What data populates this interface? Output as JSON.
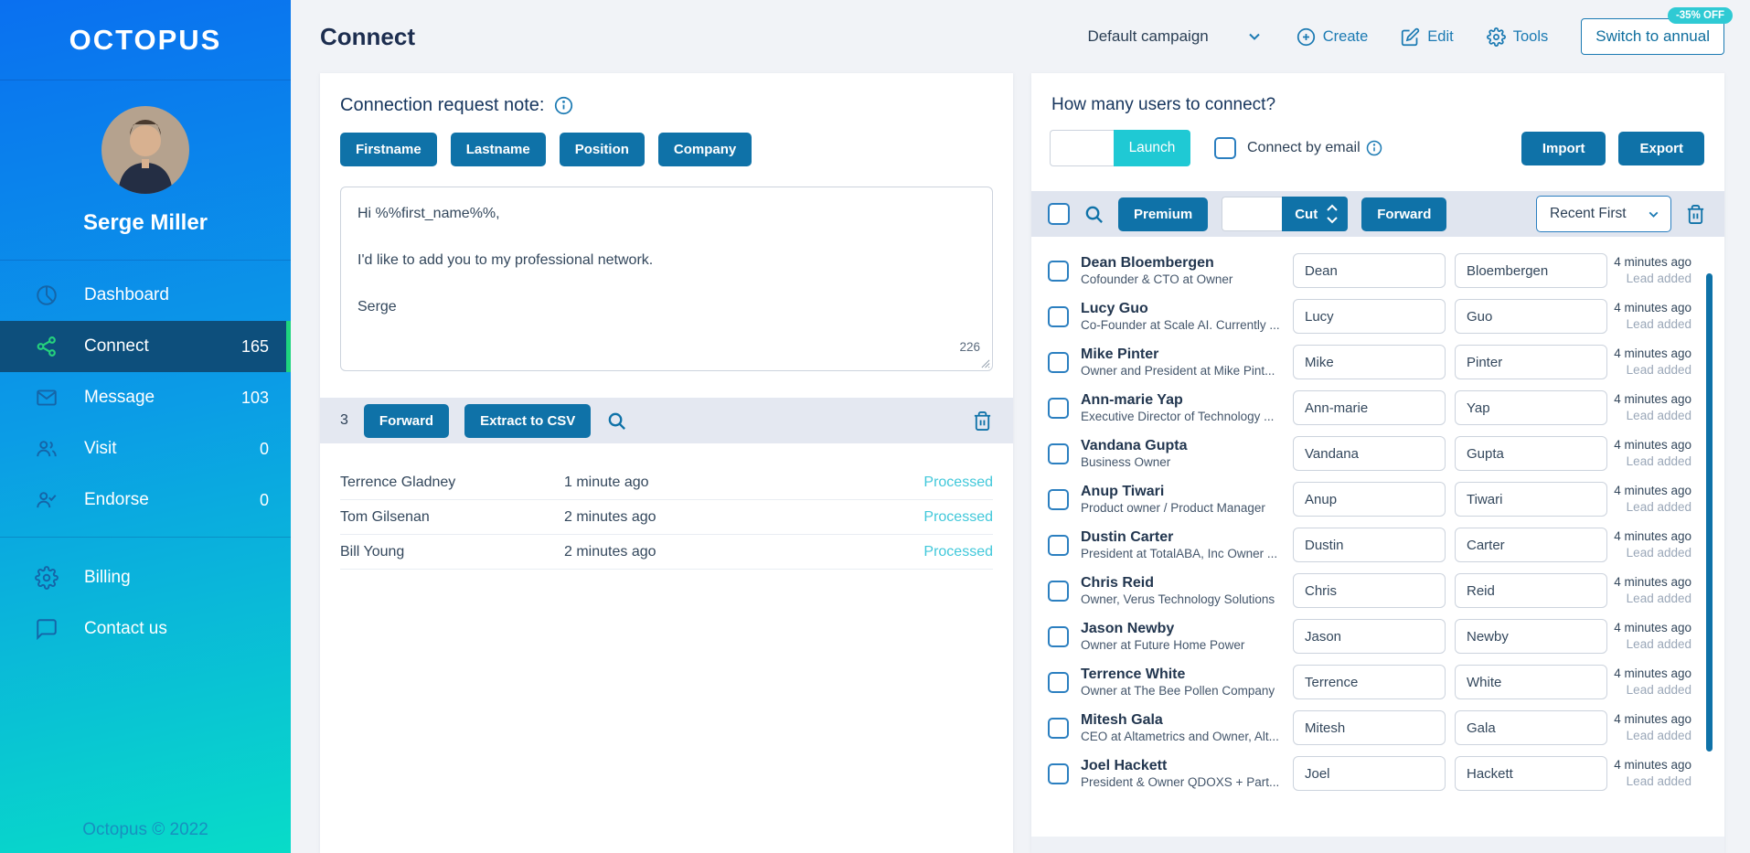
{
  "colors": {
    "accent_blue": "#0f72a8",
    "link_blue": "#1b7ab3",
    "turquoise": "#1fc9d4",
    "status_teal": "#41c8da",
    "active_nav_bg": "#0d4f7c",
    "active_nav_green": "#1ed47e",
    "sidebar_gradient_top": "#0a70f0",
    "sidebar_gradient_bottom": "#08dcc8"
  },
  "sidebar": {
    "logo": "OCTOPUS",
    "user_name": "Serge Miller",
    "items": [
      {
        "label": "Dashboard",
        "count": "",
        "icon": "pie-chart"
      },
      {
        "label": "Connect",
        "count": "165",
        "icon": "share"
      },
      {
        "label": "Message",
        "count": "103",
        "icon": "envelope"
      },
      {
        "label": "Visit",
        "count": "0",
        "icon": "people"
      },
      {
        "label": "Endorse",
        "count": "0",
        "icon": "person-check"
      }
    ],
    "secondary": [
      {
        "label": "Billing",
        "icon": "gear"
      },
      {
        "label": "Contact us",
        "icon": "chat"
      }
    ],
    "footer": "Octopus © 2022"
  },
  "header": {
    "title": "Connect",
    "campaign_selector": "Default campaign",
    "create_label": "Create",
    "edit_label": "Edit",
    "tools_label": "Tools",
    "switch_label": "Switch to annual",
    "discount_badge": "-35% OFF"
  },
  "note_panel": {
    "heading": "Connection request note:",
    "tokens": [
      "Firstname",
      "Lastname",
      "Position",
      "Company"
    ],
    "message": "Hi %%first_name%%,\n\nI'd like to add you to my professional network.\n\nSerge",
    "char_count": "226",
    "toolbar": {
      "selected_count": "3",
      "forward_label": "Forward",
      "extract_label": "Extract to CSV"
    },
    "rows": [
      {
        "name": "Terrence Gladney",
        "time": "1 minute ago",
        "status": "Processed"
      },
      {
        "name": "Tom Gilsenan",
        "time": "2 minutes ago",
        "status": "Processed"
      },
      {
        "name": "Bill Young",
        "time": "2 minutes ago",
        "status": "Processed"
      }
    ]
  },
  "connect_panel": {
    "heading": "How many users to connect?",
    "count_value": "",
    "launch_label": "Launch",
    "connect_by_email_label": "Connect by email",
    "import_label": "Import",
    "export_label": "Export",
    "toolbar": {
      "premium_label": "Premium",
      "cut_value": "",
      "cut_label": "Cut",
      "forward_label": "Forward",
      "sort_value": "Recent First"
    },
    "users": [
      {
        "name": "Dean Bloembergen",
        "title": "Cofounder & CTO at Owner",
        "first": "Dean",
        "last": "Bloembergen",
        "time": "4 minutes ago",
        "status": "Lead added"
      },
      {
        "name": "Lucy Guo",
        "title": "Co-Founder at Scale AI. Currently ...",
        "first": "Lucy",
        "last": "Guo",
        "time": "4 minutes ago",
        "status": "Lead added"
      },
      {
        "name": "Mike Pinter",
        "title": "Owner and President at Mike Pint...",
        "first": "Mike",
        "last": "Pinter",
        "time": "4 minutes ago",
        "status": "Lead added"
      },
      {
        "name": "Ann-marie Yap",
        "title": "Executive Director of Technology ...",
        "first": "Ann-marie",
        "last": "Yap",
        "time": "4 minutes ago",
        "status": "Lead added"
      },
      {
        "name": "Vandana Gupta",
        "title": "Business Owner",
        "first": "Vandana",
        "last": "Gupta",
        "time": "4 minutes ago",
        "status": "Lead added"
      },
      {
        "name": "Anup Tiwari",
        "title": "Product owner / Product Manager",
        "first": "Anup",
        "last": "Tiwari",
        "time": "4 minutes ago",
        "status": "Lead added"
      },
      {
        "name": "Dustin Carter",
        "title": "President at TotalABA, Inc Owner ...",
        "first": "Dustin",
        "last": "Carter",
        "time": "4 minutes ago",
        "status": "Lead added"
      },
      {
        "name": "Chris Reid",
        "title": "Owner, Verus Technology Solutions",
        "first": "Chris",
        "last": "Reid",
        "time": "4 minutes ago",
        "status": "Lead added"
      },
      {
        "name": "Jason Newby",
        "title": "Owner at Future Home Power",
        "first": "Jason",
        "last": "Newby",
        "time": "4 minutes ago",
        "status": "Lead added"
      },
      {
        "name": "Terrence White",
        "title": "Owner at The Bee Pollen Company",
        "first": "Terrence",
        "last": "White",
        "time": "4 minutes ago",
        "status": "Lead added"
      },
      {
        "name": "Mitesh Gala",
        "title": "CEO at Altametrics and Owner, Alt...",
        "first": "Mitesh",
        "last": "Gala",
        "time": "4 minutes ago",
        "status": "Lead added"
      },
      {
        "name": "Joel Hackett",
        "title": "President & Owner QDOXS + Part...",
        "first": "Joel",
        "last": "Hackett",
        "time": "4 minutes ago",
        "status": "Lead added"
      }
    ]
  }
}
